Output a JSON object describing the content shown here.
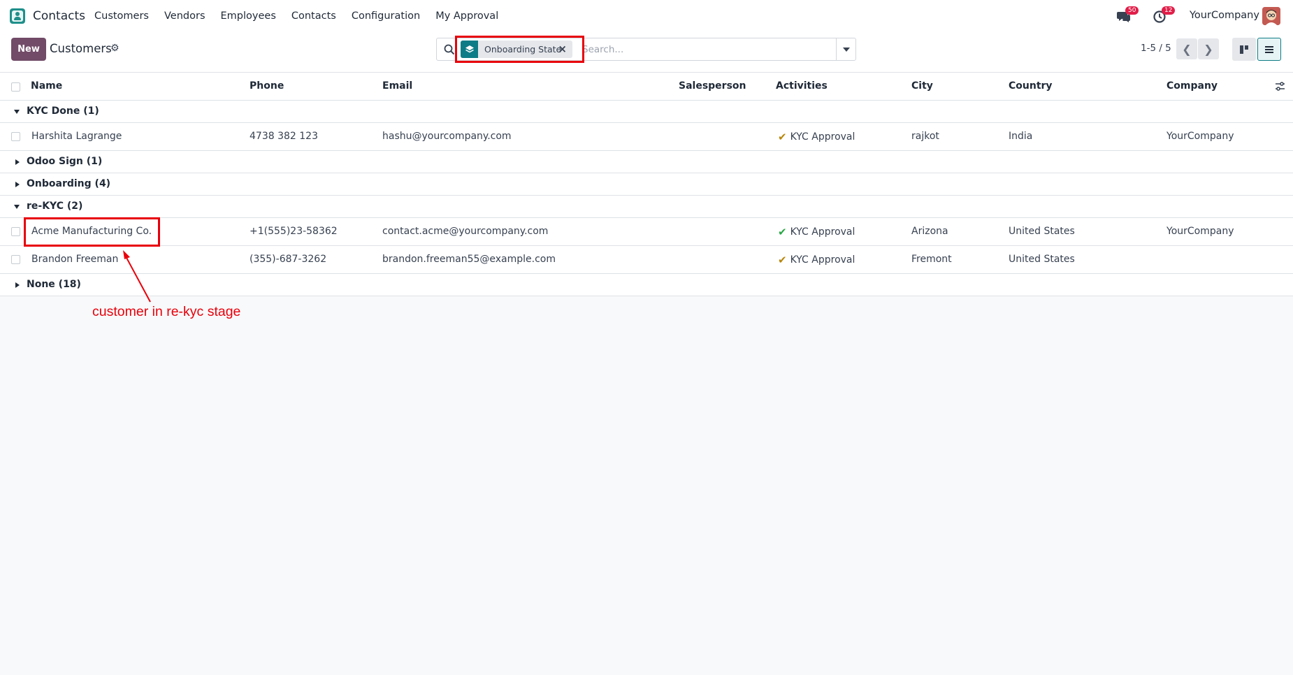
{
  "navbar": {
    "app_name": "Contacts",
    "menu": [
      "Customers",
      "Vendors",
      "Employees",
      "Contacts",
      "Configuration",
      "My Approval"
    ],
    "messages_count": "50",
    "activities_count": "12",
    "company": "YourCompany"
  },
  "control": {
    "new_label": "New",
    "breadcrumb": "Customers",
    "facet_label": "Onboarding State",
    "search_placeholder": "Search...",
    "pager": "1-5 / 5"
  },
  "columns": [
    "Name",
    "Phone",
    "Email",
    "Salesperson",
    "Activities",
    "City",
    "Country",
    "Company"
  ],
  "groups": [
    {
      "label": "KYC Done (1)",
      "open": true,
      "records": [
        {
          "name": "Harshita Lagrange",
          "phone": "4738 382 123",
          "email": "hashu@yourcompany.com",
          "salesperson": "",
          "activity": "KYC Approval",
          "activity_color": "#b8860b",
          "city": "rajkot",
          "country": "India",
          "company": "YourCompany"
        }
      ]
    },
    {
      "label": "Odoo Sign (1)",
      "open": false,
      "records": []
    },
    {
      "label": "Onboarding (4)",
      "open": false,
      "records": []
    },
    {
      "label": "re-KYC (2)",
      "open": true,
      "records": [
        {
          "name": "Acme Manufacturing Co.",
          "phone": "+1(555)23-58362",
          "email": "contact.acme@yourcompany.com",
          "salesperson": "",
          "activity": "KYC Approval",
          "activity_color": "#28a745",
          "city": "Arizona",
          "country": "United States",
          "company": "YourCompany"
        },
        {
          "name": "Brandon Freeman",
          "phone": "(355)-687-3262",
          "email": "brandon.freeman55@example.com",
          "salesperson": "",
          "activity": "KYC Approval",
          "activity_color": "#b8860b",
          "city": "Fremont",
          "country": "United States",
          "company": ""
        }
      ]
    },
    {
      "label": "None (18)",
      "open": false,
      "records": []
    }
  ],
  "annotation": {
    "text": "customer in re-kyc stage",
    "color": "#e8000b"
  },
  "colors": {
    "brand": "#714b67",
    "accent": "#0e7c86",
    "badge": "#e11d48"
  }
}
